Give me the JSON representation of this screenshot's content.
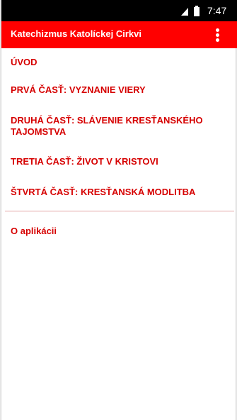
{
  "status_bar": {
    "time": "7:47",
    "signal_icon": "signal-icon",
    "battery_icon": "battery-icon"
  },
  "app_bar": {
    "title": "Katechizmus Katolíckej Cirkvi",
    "menu_icon": "overflow-menu-icon"
  },
  "menu": {
    "items": [
      {
        "label": "ÚVOD"
      },
      {
        "label": "PRVÁ ČASŤ: VYZNANIE VIERY"
      },
      {
        "label": "DRUHÁ ČASŤ: SLÁVENIE KRESŤANSKÉHO TAJOMSTVA"
      },
      {
        "label": "TRETIA ČASŤ: ŽIVOT V KRISTOVI"
      },
      {
        "label": "ŠTVRTÁ ČASŤ: KRESŤANSKÁ MODLITBA"
      }
    ],
    "about_label": "O aplikácii"
  },
  "colors": {
    "accent": "#ff0000",
    "menu_text": "#d60000",
    "status_bar": "#000000"
  }
}
